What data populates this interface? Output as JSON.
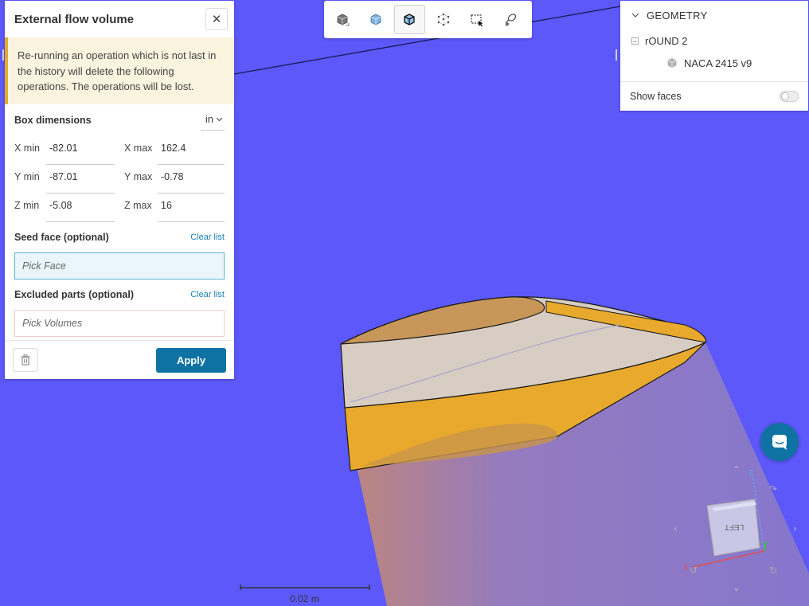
{
  "colors": {
    "viewport_background": "#5c58fa",
    "accent_blue": "#0f72a3",
    "warning_background": "#faf3de",
    "warning_border": "#e2ad2b",
    "wing_orange": "#e8a92c"
  },
  "panel": {
    "title": "External flow volume",
    "close_icon": "close-icon",
    "warning_text": "Re-running an operation which is not last in the history will delete the following operations. The operations will be lost.",
    "box_dimensions_label": "Box dimensions",
    "unit": "in",
    "dimensions": {
      "xmin_label": "X min",
      "xmin_value": "-82.01",
      "xmax_label": "X max",
      "xmax_value": "162.4",
      "ymin_label": "Y min",
      "ymin_value": "-87.01",
      "ymax_label": "Y max",
      "ymax_value": "-0.78",
      "zmin_label": "Z min",
      "zmin_value": "-5.08",
      "zmax_label": "Z max",
      "zmax_value": "16"
    },
    "seed_face_label": "Seed face (optional)",
    "seed_face_clear": "Clear list",
    "seed_face_placeholder": "Pick Face",
    "excluded_label": "Excluded parts (optional)",
    "excluded_clear": "Clear list",
    "excluded_placeholder": "Pick Volumes",
    "apply_label": "Apply"
  },
  "toolbar": {
    "tools": [
      "box-view-icon",
      "cube-solid-icon",
      "cube-edges-icon",
      "cube-points-icon",
      "box-select-icon",
      "lasso-select-icon"
    ],
    "active_index": 2
  },
  "tree": {
    "header": "GEOMETRY",
    "root": "rOUND 2",
    "child": "NACA 2415 v9",
    "show_faces_label": "Show faces",
    "show_faces_on": false
  },
  "viewport": {
    "scale_label": "0.02 m",
    "cube_label": "LEFT"
  }
}
